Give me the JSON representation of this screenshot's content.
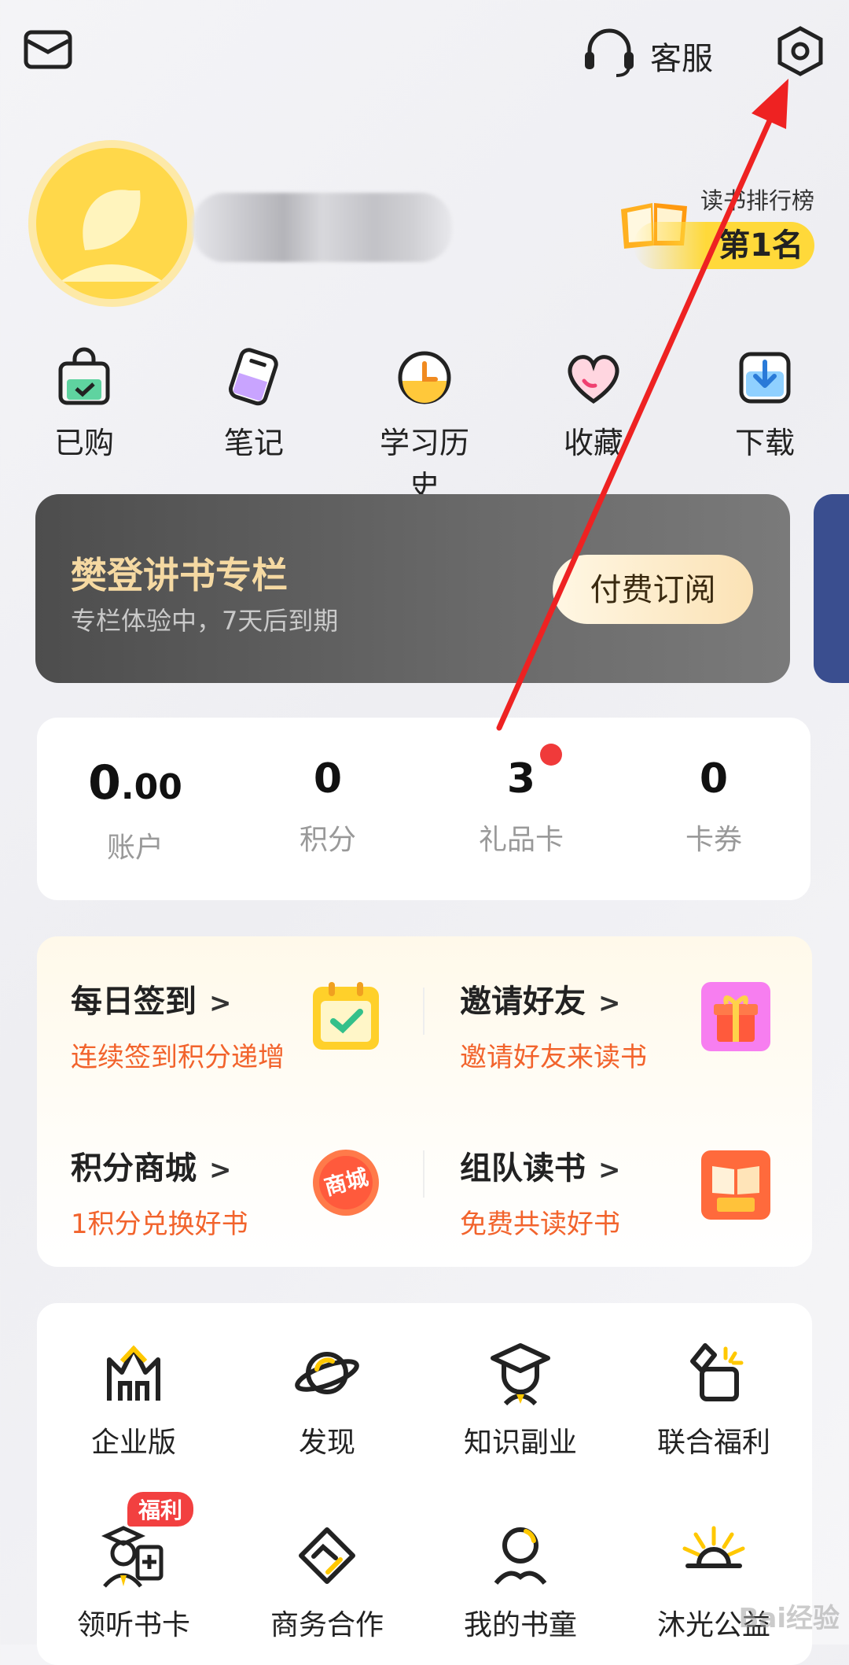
{
  "header": {
    "mail_icon": "mail-icon",
    "support_label": "客服",
    "settings_icon": "settings-icon"
  },
  "profile": {
    "rank_title": "读书排行榜",
    "rank_value": "第1名"
  },
  "quick_actions": [
    {
      "label": "已购",
      "icon": "bag-icon"
    },
    {
      "label": "笔记",
      "icon": "note-icon"
    },
    {
      "label": "学习历史",
      "icon": "clock-icon"
    },
    {
      "label": "收藏",
      "icon": "heart-icon"
    },
    {
      "label": "下载",
      "icon": "download-icon"
    }
  ],
  "column_banner": {
    "title": "樊登讲书专栏",
    "subtitle": "专栏体验中，7天后到期",
    "button": "付费订阅"
  },
  "stats": [
    {
      "value_int": "0",
      "value_dec": ".00",
      "label": "账户"
    },
    {
      "value": "0",
      "label": "积分"
    },
    {
      "value": "3",
      "label": "礼品卡"
    },
    {
      "value": "0",
      "label": "卡券"
    }
  ],
  "tasks": [
    {
      "title": "每日签到",
      "subtitle": "连续签到积分递增",
      "icon": "calendar-check-icon"
    },
    {
      "title": "邀请好友",
      "subtitle": "邀请好友来读书",
      "icon": "gift-icon"
    },
    {
      "title": "积分商城",
      "subtitle": "1积分兑换好书",
      "icon": "mall-icon",
      "icon_text": "商城"
    },
    {
      "title": "组队读书",
      "subtitle": "免费共读好书",
      "icon": "team-book-icon"
    }
  ],
  "chevron": ">",
  "services": [
    {
      "label": "企业版",
      "icon": "enterprise-icon"
    },
    {
      "label": "发现",
      "icon": "planet-icon"
    },
    {
      "label": "知识副业",
      "icon": "graduate-icon"
    },
    {
      "label": "联合福利",
      "icon": "coupon-icon"
    },
    {
      "label": "领听书卡",
      "icon": "listen-card-icon"
    },
    {
      "label": "商务合作",
      "icon": "handshake-icon"
    },
    {
      "label": "我的书童",
      "icon": "reader-icon"
    },
    {
      "label": "沐光公益",
      "icon": "sunrise-icon"
    }
  ],
  "welfare_badge": "福利",
  "colors": {
    "accent": "#f2632c",
    "badge_red": "#f24040",
    "brand_yellow": "#ffd93a"
  }
}
